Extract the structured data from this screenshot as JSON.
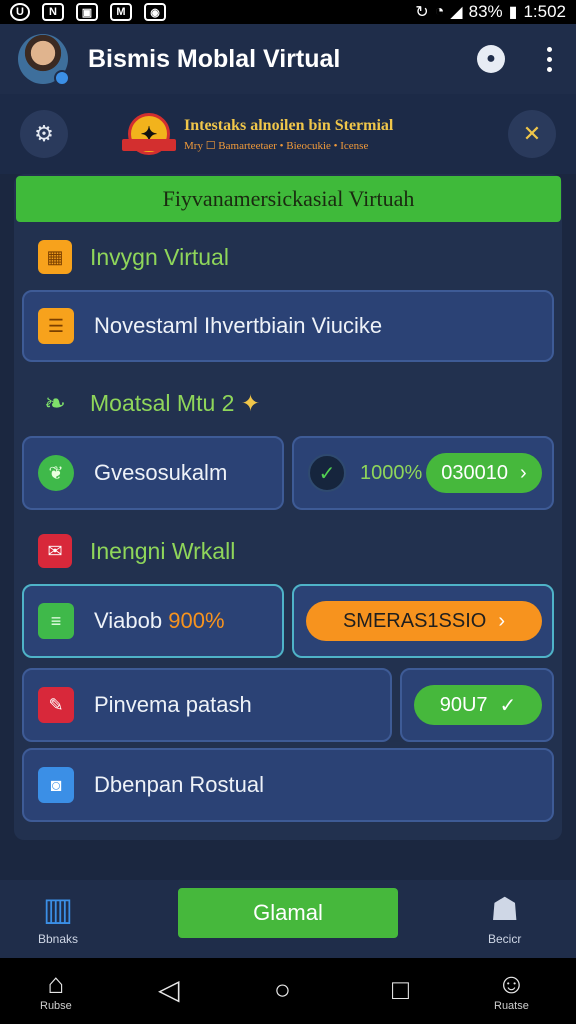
{
  "status_bar": {
    "left_icons": [
      "circle-u-icon",
      "news-icon",
      "gallery-icon",
      "mail-icon",
      "camera-icon"
    ],
    "left_texts": [
      "U",
      "N",
      "▣",
      "M",
      "◉"
    ],
    "battery": "83%",
    "time": "1:502"
  },
  "app_bar": {
    "title": "Bismis Moblal Virtual"
  },
  "banner": {
    "logo_mark": "✦",
    "title": "Intestaks alnoilen bin Stermial",
    "subtitle": "Mry  ☐ Bamarteetaer  •  Bieocukie  •  Icense"
  },
  "green_header": "Fiyvanamersickasial Virtuah",
  "sections": [
    {
      "label": "Invygn Virtual"
    },
    {
      "label": "Moatsal Mtu 2",
      "star": "✦"
    },
    {
      "label": "Inengni Wrkall"
    }
  ],
  "cards": {
    "row1": {
      "label": "Novestaml Ihvertbiain Viucike"
    },
    "row2_left": {
      "label": "Gvesosukalm"
    },
    "row2_right": {
      "value": "1000%",
      "pill": "030010",
      "pill_arrow": "›"
    },
    "row3_left": {
      "label": "Viabob",
      "percent": "900%"
    },
    "row3_right": {
      "pill": "SMERAS1SSIO",
      "pill_arrow": "›"
    },
    "row4_left": {
      "label": "Pinvema patash"
    },
    "row4_right": {
      "pill": "90U7",
      "pill_arrow": "✓"
    },
    "row5": {
      "label": "Dbenpan Rostual"
    }
  },
  "bottom_nav": {
    "left_label": "Bbnaks",
    "cta": "Glamal",
    "right_label": "Becicr"
  },
  "system_nav": {
    "home_label": "Rubse",
    "apps_label": "Ruatse"
  },
  "colors": {
    "background": "#1b2740",
    "accent_green": "#46b83c",
    "accent_orange": "#f7931e",
    "card_blue": "#2b4275",
    "label_green": "#8fd65a"
  }
}
